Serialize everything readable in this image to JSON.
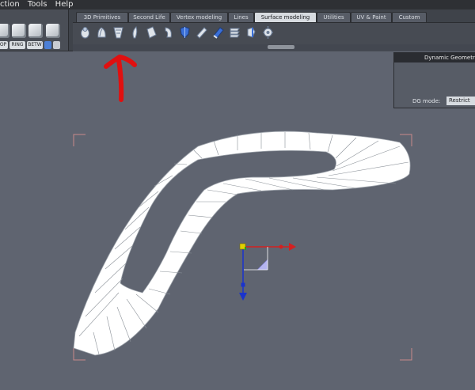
{
  "menu": [
    "ction",
    "Tools",
    "Help"
  ],
  "left_buttons": [
    "OP",
    "RING",
    "BETW"
  ],
  "tabs": [
    {
      "label": "3D Primitives",
      "active": false
    },
    {
      "label": "Second Life",
      "active": false
    },
    {
      "label": "Vertex modeling",
      "active": false
    },
    {
      "label": "Lines",
      "active": false
    },
    {
      "label": "Surface modeling",
      "active": true
    },
    {
      "label": "Utilities",
      "active": false
    },
    {
      "label": "UV & Paint",
      "active": false
    },
    {
      "label": "Custom",
      "active": false
    }
  ],
  "toolbar_icons": [
    "surface-tool-1-icon",
    "surface-tool-2-icon",
    "surface-tool-3-icon",
    "surface-tool-4-icon",
    "surface-tool-5-icon",
    "surface-tool-6-icon",
    "surface-tool-7-icon",
    "surface-tool-8-icon",
    "surface-tool-9-icon",
    "surface-tool-10-icon",
    "surface-tool-11-icon",
    "surface-tool-12-icon"
  ],
  "dynamic_geometry": {
    "title": "Dynamic Geometry",
    "mode_label": "DG mode:",
    "mode_value": "Restrict"
  },
  "annotation_color": "#e01010",
  "gizmo_colors": {
    "x": "#d42020",
    "y": "#e0d000",
    "z": "#1a33cc",
    "plane": "#b4b4f0"
  }
}
